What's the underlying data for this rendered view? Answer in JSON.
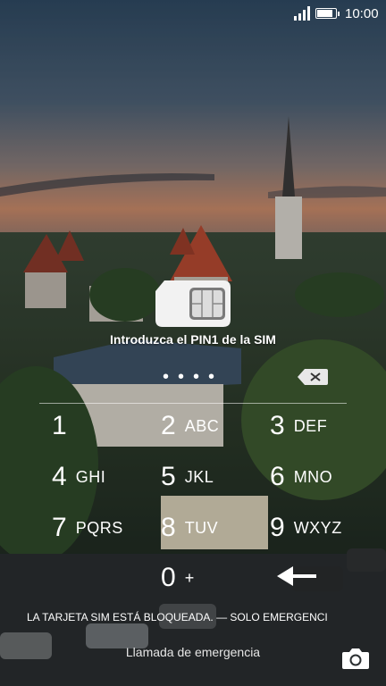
{
  "status": {
    "time": "10:00",
    "battery_level": 0.9
  },
  "pin": {
    "title": "Introduzca el PIN1 de la SIM",
    "entered_digits": 4,
    "dots": "••••"
  },
  "keypad": [
    {
      "num": "1",
      "letters": ""
    },
    {
      "num": "2",
      "letters": "ABC"
    },
    {
      "num": "3",
      "letters": "DEF"
    },
    {
      "num": "4",
      "letters": "GHI"
    },
    {
      "num": "5",
      "letters": "JKL"
    },
    {
      "num": "6",
      "letters": "MNO"
    },
    {
      "num": "7",
      "letters": "PQRS"
    },
    {
      "num": "8",
      "letters": "TUV"
    },
    {
      "num": "9",
      "letters": "WXYZ"
    },
    {
      "num": "0",
      "letters": "+"
    }
  ],
  "footer": {
    "locked_message": "LA TARJETA SIM ESTÁ BLOQUEADA. — SOLO EMERGENCI",
    "emergency_call": "Llamada de emergencia"
  },
  "icons": {
    "signal": "signal-icon",
    "battery": "battery-icon",
    "sim": "sim-card-icon",
    "delete": "delete-icon",
    "backspace": "back-arrow-icon",
    "camera": "camera-icon"
  }
}
